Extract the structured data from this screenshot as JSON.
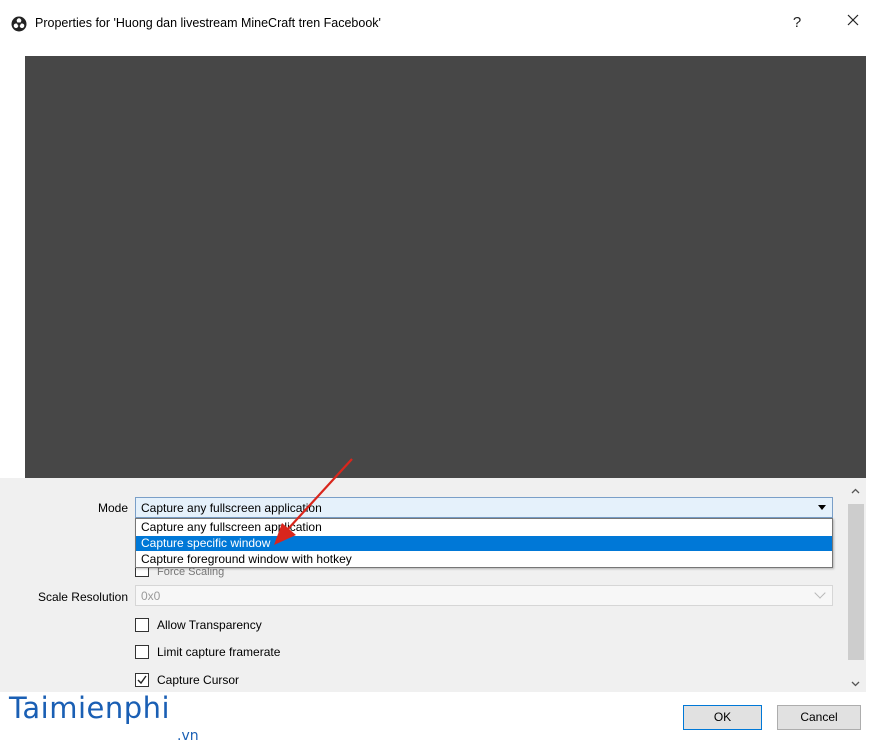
{
  "window": {
    "title": "Properties for 'Huong dan livestream MineCraft tren Facebook'",
    "help_label": "?",
    "app_icon": "obs-logo-icon",
    "close_icon": "close-icon"
  },
  "preview": {
    "background_color": "#474747"
  },
  "mode": {
    "label": "Mode",
    "selected": "Capture any fullscreen application",
    "options": [
      "Capture any fullscreen application",
      "Capture specific window",
      "Capture foreground window with hotkey"
    ],
    "highlighted_index": 1
  },
  "hidden_option_text": "Force Scaling",
  "scale_resolution": {
    "label": "Scale Resolution",
    "value": "0x0"
  },
  "checkboxes": [
    {
      "label": "Allow Transparency",
      "checked": false
    },
    {
      "label": "Limit capture framerate",
      "checked": false
    },
    {
      "label": "Capture Cursor",
      "checked": true
    }
  ],
  "buttons": {
    "ok": "OK",
    "cancel": "Cancel"
  },
  "watermark": {
    "main": "Taimienphi",
    "sub": ".vn"
  },
  "colors": {
    "accent": "#0078d7",
    "annotation_arrow": "#d9261c",
    "watermark": "#1a5fb4"
  }
}
